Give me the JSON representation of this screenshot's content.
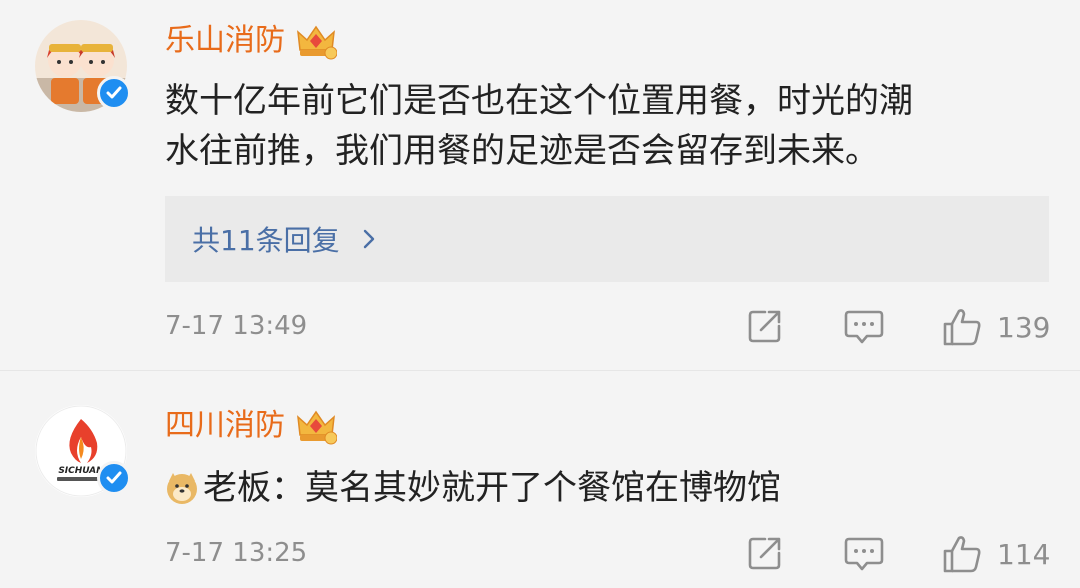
{
  "comments": [
    {
      "username": "乐山消防",
      "text_line1": "数十亿年前它们是否也在这个位置用餐，时光的潮",
      "text_line2": "水往前推，我们用餐的足迹是否会留存到未来。",
      "replies_label": "共11条回复",
      "time": "7-17 13:49",
      "likes": "139"
    },
    {
      "username": "四川消防",
      "text": "老板：莫名其妙就开了个餐馆在博物馆",
      "time": "7-17 13:25",
      "likes": "114"
    }
  ],
  "colors": {
    "username": "#e86b1a",
    "reply_link": "#4a6fa6",
    "meta_gray": "#8e8e8e",
    "verified_blue": "#1f8ef1"
  },
  "icons": [
    "verified-icon",
    "crown-icon",
    "doge-emoji-icon",
    "chevron-right-icon",
    "share-icon",
    "comment-icon",
    "like-icon"
  ]
}
